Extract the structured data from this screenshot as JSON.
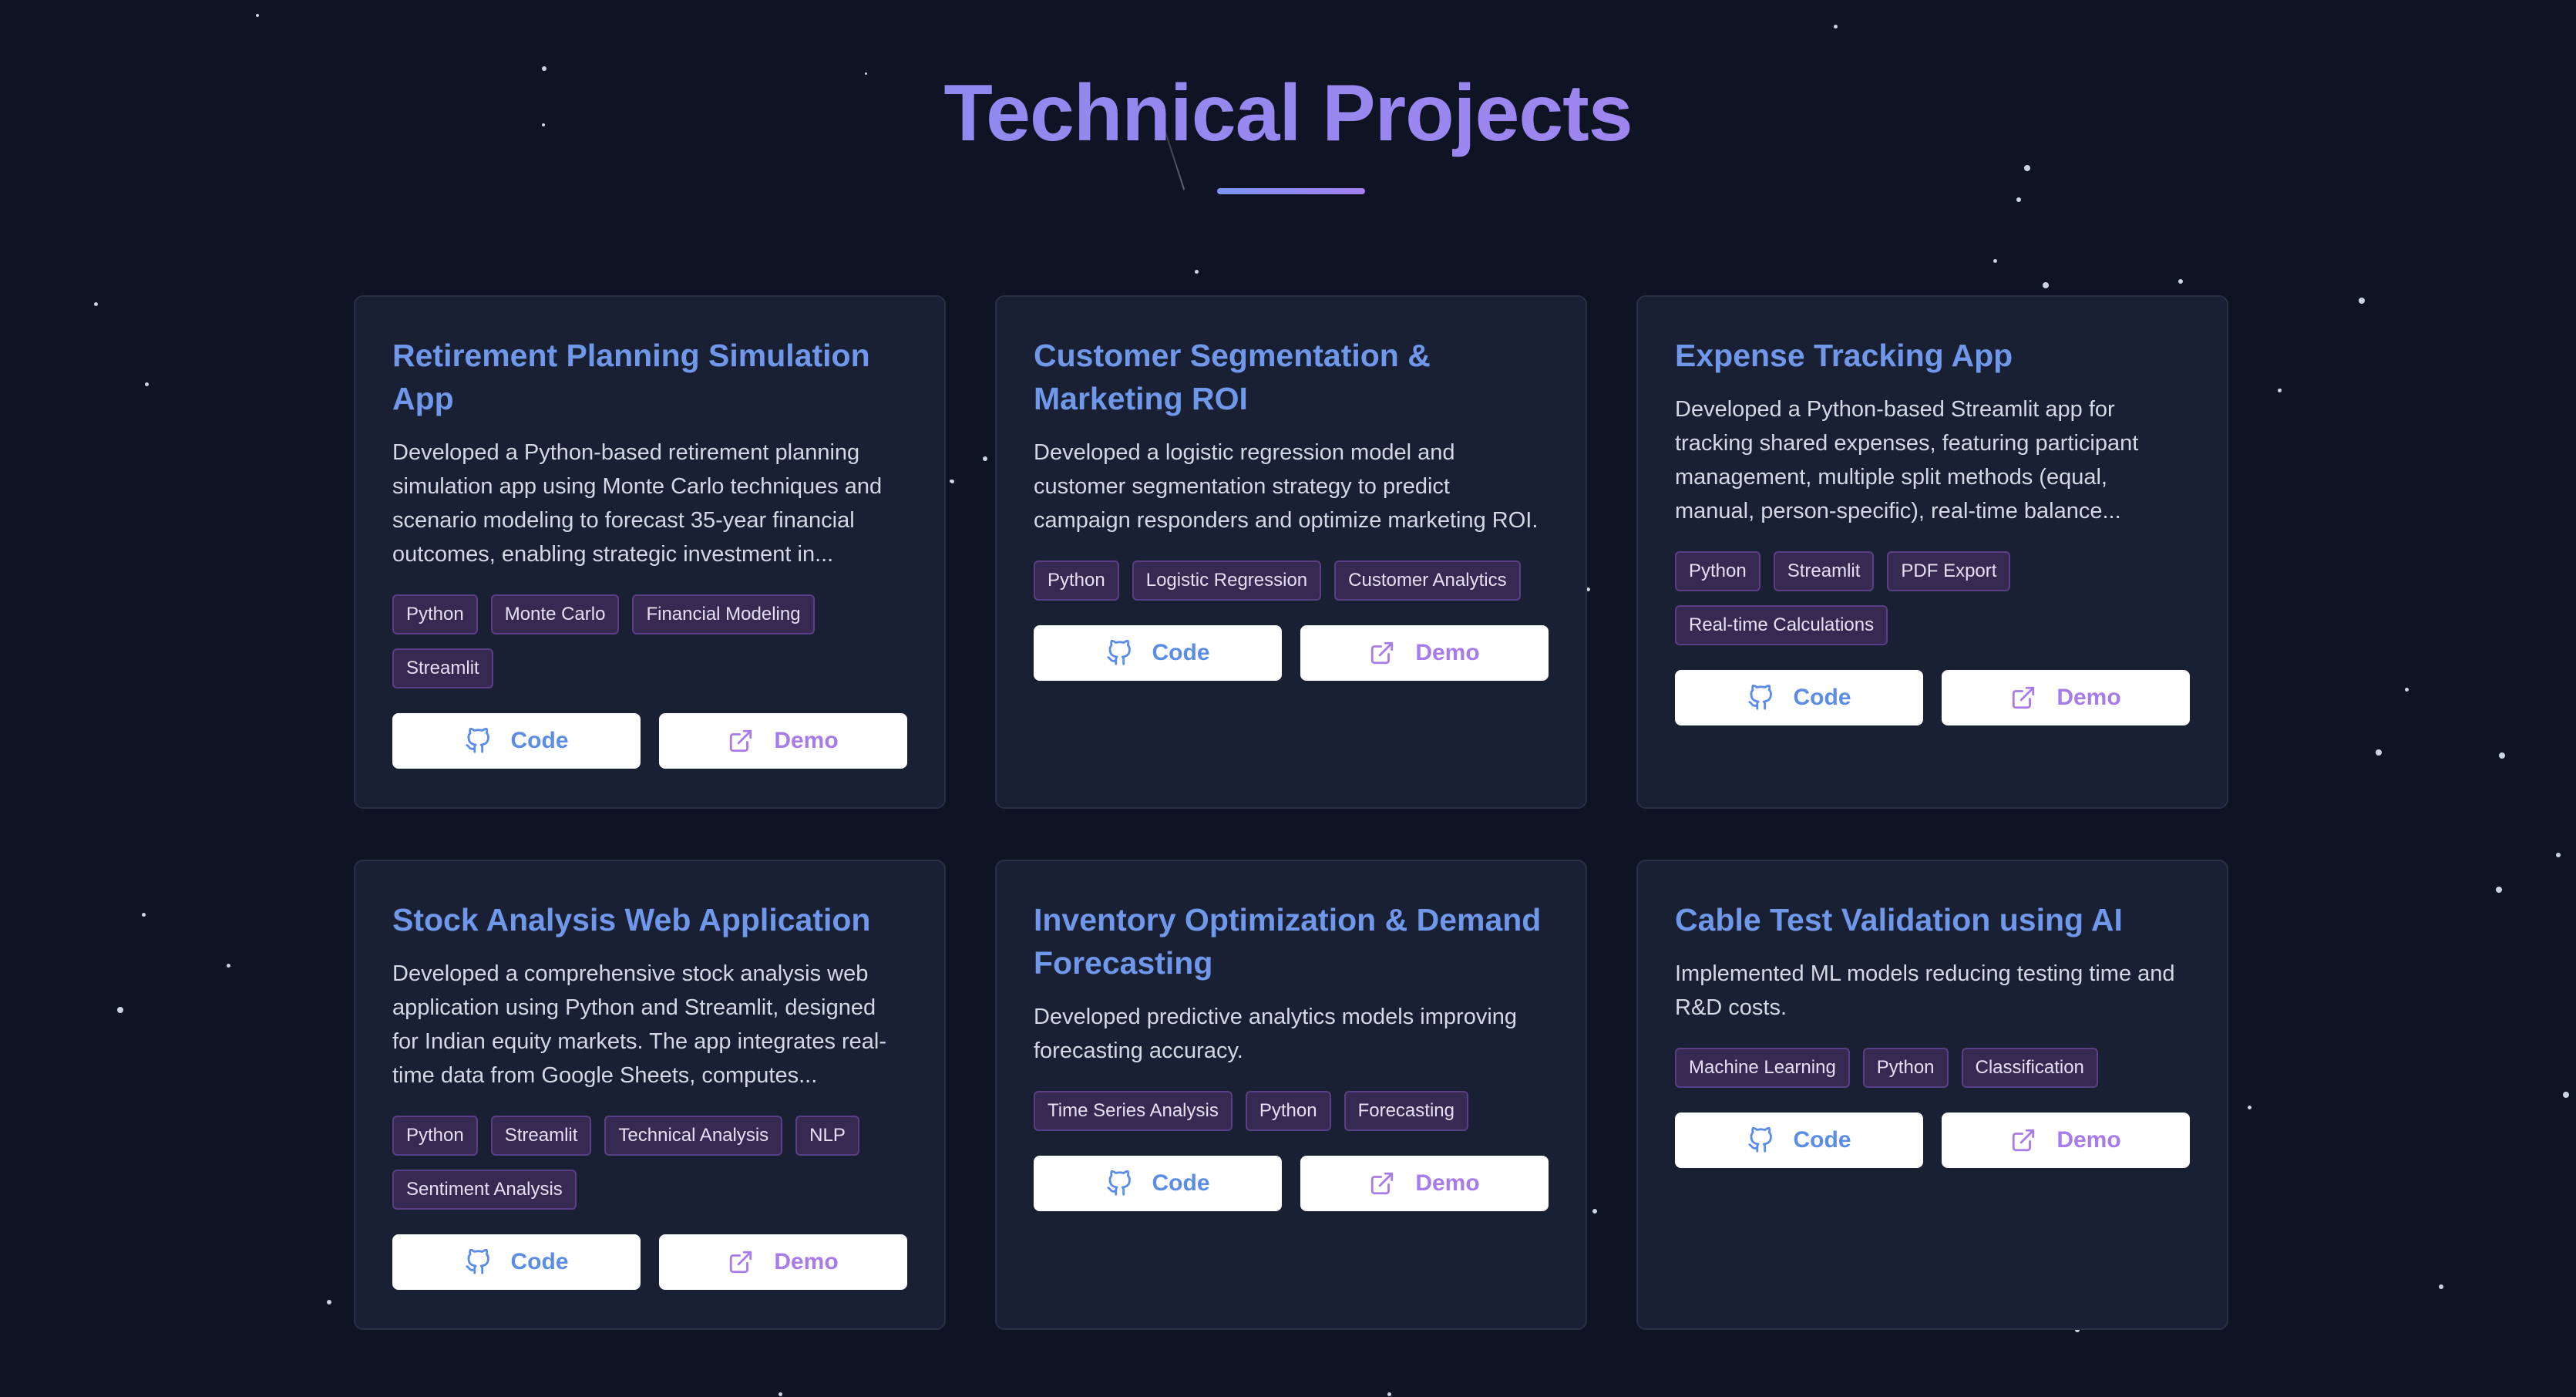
{
  "section": {
    "title": "Technical Projects"
  },
  "colors": {
    "background": "#0f1424",
    "card": "#1a2033",
    "card_title": "#6f97ea",
    "tag_bg": "#372a52",
    "tag_border": "#5b3f86",
    "code_button_text": "#5b8de6",
    "demo_button_text": "#a77be8"
  },
  "icons": {
    "code": "github-icon",
    "demo": "external-link-icon"
  },
  "projects": [
    {
      "title": "Retirement Planning Simulation App",
      "description": "Developed a Python-based retirement planning simulation app using Monte Carlo techniques and scenario modeling to forecast 35-year financial outcomes, enabling strategic investment in...",
      "tags": [
        "Python",
        "Monte Carlo",
        "Financial Modeling",
        "Streamlit"
      ],
      "code_label": "Code",
      "demo_label": "Demo"
    },
    {
      "title": "Customer Segmentation & Marketing ROI",
      "description": "Developed a logistic regression model and customer segmentation strategy to predict campaign responders and optimize marketing ROI.",
      "tags": [
        "Python",
        "Logistic Regression",
        "Customer Analytics"
      ],
      "code_label": "Code",
      "demo_label": "Demo"
    },
    {
      "title": "Expense Tracking App",
      "description": "Developed a Python-based Streamlit app for tracking shared expenses, featuring participant management, multiple split methods (equal, manual, person-specific), real-time balance...",
      "tags": [
        "Python",
        "Streamlit",
        "PDF Export",
        "Real-time Calculations"
      ],
      "code_label": "Code",
      "demo_label": "Demo"
    },
    {
      "title": "Stock Analysis Web Application",
      "description": "Developed a comprehensive stock analysis web application using Python and Streamlit, designed for Indian equity markets. The app integrates real-time data from Google Sheets, computes...",
      "tags": [
        "Python",
        "Streamlit",
        "Technical Analysis",
        "NLP",
        "Sentiment Analysis"
      ],
      "code_label": "Code",
      "demo_label": "Demo"
    },
    {
      "title": "Inventory Optimization & Demand Forecasting",
      "description": "Developed predictive analytics models improving forecasting accuracy.",
      "tags": [
        "Time Series Analysis",
        "Python",
        "Forecasting"
      ],
      "code_label": "Code",
      "demo_label": "Demo"
    },
    {
      "title": "Cable Test Validation using AI",
      "description": "Implemented ML models reducing testing time and R&D costs.",
      "tags": [
        "Machine Learning",
        "Python",
        "Classification"
      ],
      "code_label": "Code",
      "demo_label": "Demo"
    }
  ]
}
